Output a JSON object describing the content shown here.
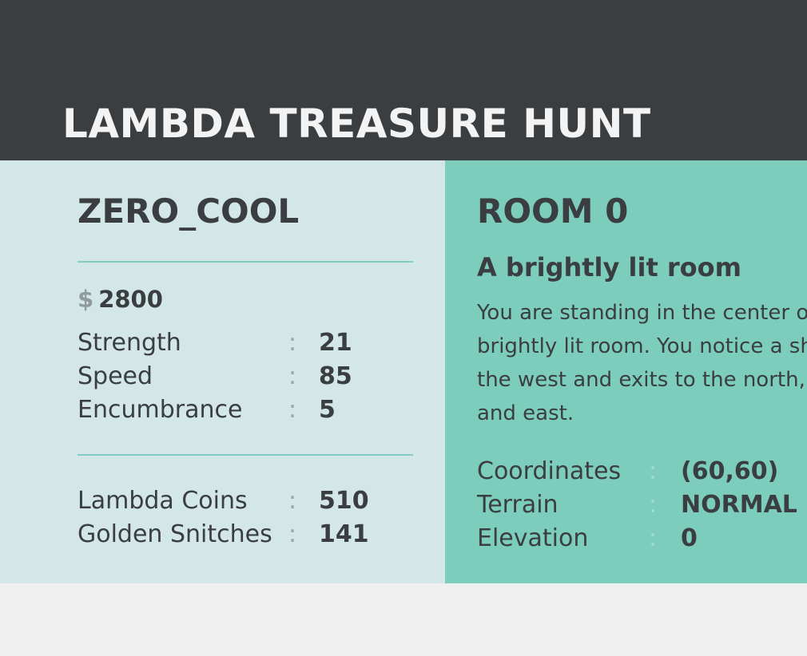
{
  "header": {
    "title": "LAMBDA TREASURE HUNT"
  },
  "player": {
    "name": "ZERO_COOL",
    "currency_symbol": "$",
    "gold": "2800",
    "stats": [
      {
        "label": "Strength",
        "sep": ":",
        "value": "21"
      },
      {
        "label": "Speed",
        "sep": ":",
        "value": "85"
      },
      {
        "label": "Encumbrance",
        "sep": ":",
        "value": "5"
      }
    ],
    "collectibles": [
      {
        "label": "Lambda Coins",
        "sep": ":",
        "value": "510"
      },
      {
        "label": "Golden Snitches",
        "sep": ":",
        "value": "141"
      }
    ]
  },
  "room": {
    "title": "ROOM 0",
    "subtitle": "A brightly lit room",
    "description": "You are standing in the center of a brightly lit room. You notice a shop to the west and exits to the north, south and east.",
    "details": [
      {
        "label": "Coordinates",
        "sep": ":",
        "value": "(60,60)"
      },
      {
        "label": "Terrain",
        "sep": ":",
        "value": "NORMAL"
      },
      {
        "label": "Elevation",
        "sep": ":",
        "value": "0"
      }
    ]
  }
}
